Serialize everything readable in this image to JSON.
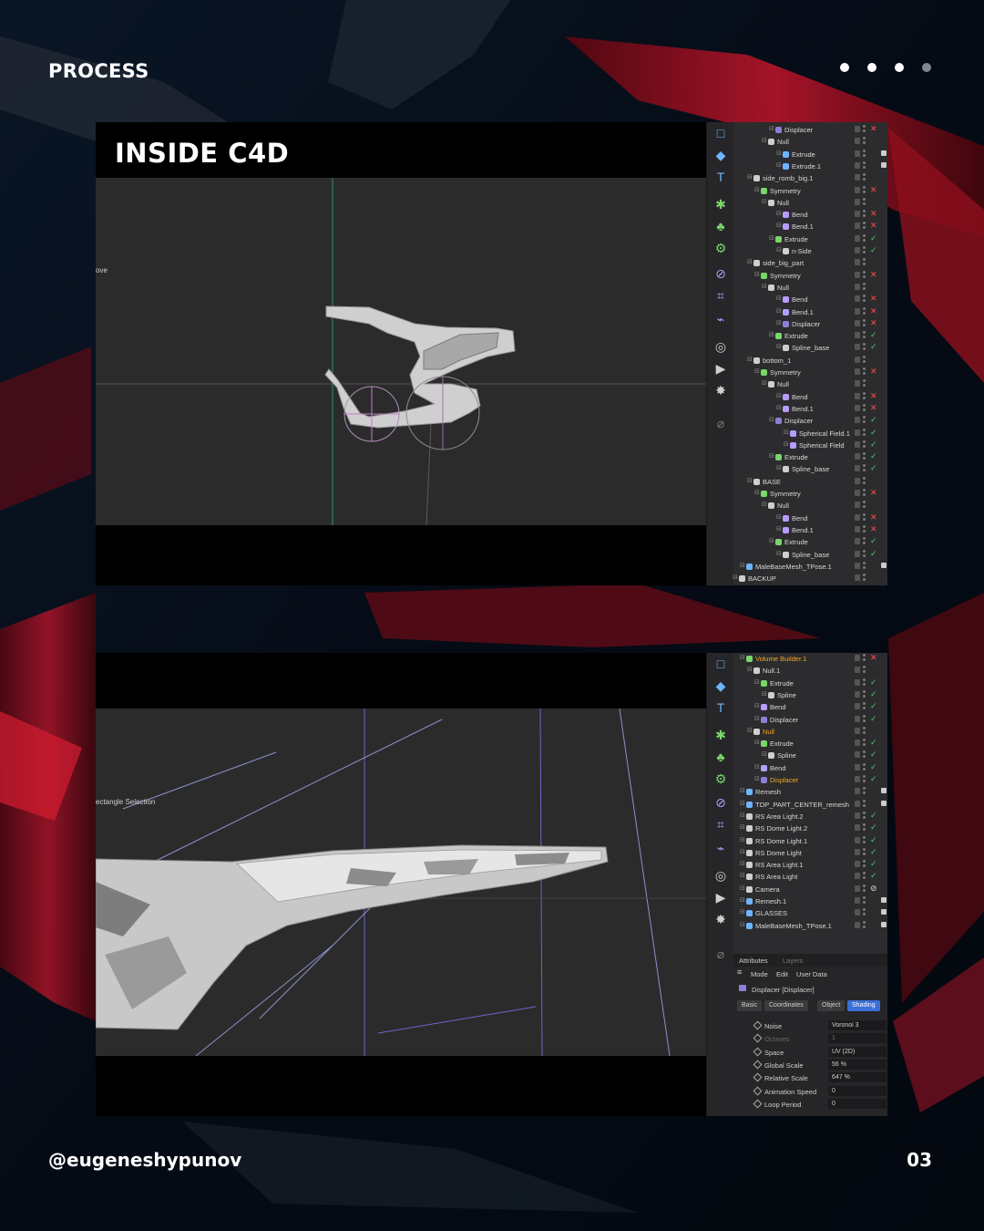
{
  "header": {
    "label": "PROCESS",
    "dots": [
      true,
      true,
      true,
      false
    ]
  },
  "footer": {
    "handle": "@eugeneshypunov",
    "page": "03"
  },
  "colors": {
    "background": "#06101e",
    "accent_red": "#b01622",
    "viewport": "#2b2b2c",
    "active_tab": "#3b6fd8"
  },
  "window1": {
    "title": "INSIDE C4D",
    "viewport_tool": "ove",
    "tree": [
      {
        "label": "Displacer",
        "indent": 5,
        "icon": "displacer-icon",
        "flag": "x"
      },
      {
        "label": "Null",
        "indent": 4,
        "icon": "null-icon",
        "flag": ""
      },
      {
        "label": "Extrude",
        "indent": 6,
        "icon": "mesh-icon",
        "flag": "tag"
      },
      {
        "label": "Extrude.1",
        "indent": 6,
        "icon": "mesh-icon",
        "flag": "tag"
      },
      {
        "label": "side_romb_big.1",
        "indent": 2,
        "icon": "null-icon",
        "flag": ""
      },
      {
        "label": "Symmetry",
        "indent": 3,
        "icon": "symmetry-icon",
        "flag": "x"
      },
      {
        "label": "Null",
        "indent": 4,
        "icon": "null-icon",
        "flag": ""
      },
      {
        "label": "Bend",
        "indent": 6,
        "icon": "deformer-icon",
        "flag": "x"
      },
      {
        "label": "Bend.1",
        "indent": 6,
        "icon": "deformer-icon",
        "flag": "x"
      },
      {
        "label": "Extrude",
        "indent": 5,
        "icon": "extrude-icon",
        "flag": "ok"
      },
      {
        "label": "n-Side",
        "indent": 6,
        "icon": "spline-icon",
        "flag": "ok"
      },
      {
        "label": "side_big_part",
        "indent": 2,
        "icon": "null-icon",
        "flag": ""
      },
      {
        "label": "Symmetry",
        "indent": 3,
        "icon": "symmetry-icon",
        "flag": "x"
      },
      {
        "label": "Null",
        "indent": 4,
        "icon": "null-icon",
        "flag": ""
      },
      {
        "label": "Bend",
        "indent": 6,
        "icon": "deformer-icon",
        "flag": "x"
      },
      {
        "label": "Bend.1",
        "indent": 6,
        "icon": "deformer-icon",
        "flag": "x"
      },
      {
        "label": "Displacer",
        "indent": 6,
        "icon": "displacer-icon",
        "flag": "x"
      },
      {
        "label": "Extrude",
        "indent": 5,
        "icon": "extrude-icon",
        "flag": "ok"
      },
      {
        "label": "Spline_base",
        "indent": 6,
        "icon": "spline-icon",
        "flag": "ok"
      },
      {
        "label": "bottom_1",
        "indent": 2,
        "icon": "null-icon",
        "flag": ""
      },
      {
        "label": "Symmetry",
        "indent": 3,
        "icon": "symmetry-icon",
        "flag": "x"
      },
      {
        "label": "Null",
        "indent": 4,
        "icon": "null-icon",
        "flag": ""
      },
      {
        "label": "Bend",
        "indent": 6,
        "icon": "deformer-icon",
        "flag": "x"
      },
      {
        "label": "Bend.1",
        "indent": 6,
        "icon": "deformer-icon",
        "flag": "x"
      },
      {
        "label": "Displacer",
        "indent": 5,
        "icon": "displacer-icon",
        "flag": "ok"
      },
      {
        "label": "Spherical Field.1",
        "indent": 7,
        "icon": "field-icon",
        "flag": "ok"
      },
      {
        "label": "Spherical Field",
        "indent": 7,
        "icon": "field-icon",
        "flag": "ok"
      },
      {
        "label": "Extrude",
        "indent": 5,
        "icon": "extrude-icon",
        "flag": "ok"
      },
      {
        "label": "Spline_base",
        "indent": 6,
        "icon": "spline-icon",
        "flag": "ok"
      },
      {
        "label": "BASE",
        "indent": 2,
        "icon": "null-icon",
        "flag": ""
      },
      {
        "label": "Symmetry",
        "indent": 3,
        "icon": "symmetry-icon",
        "flag": "x"
      },
      {
        "label": "Null",
        "indent": 4,
        "icon": "null-icon",
        "flag": ""
      },
      {
        "label": "Bend",
        "indent": 6,
        "icon": "deformer-icon",
        "flag": "x"
      },
      {
        "label": "Bend.1",
        "indent": 6,
        "icon": "deformer-icon",
        "flag": "x"
      },
      {
        "label": "Extrude",
        "indent": 5,
        "icon": "extrude-icon",
        "flag": "ok"
      },
      {
        "label": "Spline_base",
        "indent": 6,
        "icon": "spline-icon",
        "flag": "ok"
      },
      {
        "label": "MaleBaseMesh_TPose.1",
        "indent": 1,
        "icon": "mesh-icon",
        "flag": "tag"
      },
      {
        "label": "BACKUP",
        "indent": 0,
        "icon": "null-icon",
        "flag": ""
      }
    ]
  },
  "window2": {
    "viewport_tool": "ectangle Selection",
    "tree": [
      {
        "label": "Volume Builder.1",
        "indent": 1,
        "icon": "volume-icon",
        "flag": "x",
        "hl": true
      },
      {
        "label": "Null.1",
        "indent": 2,
        "icon": "null-icon",
        "flag": ""
      },
      {
        "label": "Extrude",
        "indent": 3,
        "icon": "extrude-icon",
        "flag": "ok"
      },
      {
        "label": "Spline",
        "indent": 4,
        "icon": "spline-icon",
        "flag": "ok"
      },
      {
        "label": "Bend",
        "indent": 3,
        "icon": "deformer-icon",
        "flag": "ok"
      },
      {
        "label": "Displacer",
        "indent": 3,
        "icon": "displacer-icon",
        "flag": "ok"
      },
      {
        "label": "Null",
        "indent": 2,
        "icon": "null-icon",
        "flag": "",
        "hl": true
      },
      {
        "label": "Extrude",
        "indent": 3,
        "icon": "extrude-icon",
        "flag": "ok"
      },
      {
        "label": "Spline",
        "indent": 4,
        "icon": "spline-icon",
        "flag": "ok"
      },
      {
        "label": "Bend",
        "indent": 3,
        "icon": "deformer-icon",
        "flag": "ok"
      },
      {
        "label": "Displacer",
        "indent": 3,
        "icon": "displacer-icon",
        "flag": "ok",
        "hl": true
      },
      {
        "label": "Remesh",
        "indent": 1,
        "icon": "mesh-icon",
        "flag": "tag"
      },
      {
        "label": "TOP_PART_CENTER_remesh",
        "indent": 1,
        "icon": "mesh-icon",
        "flag": "tag"
      },
      {
        "label": "RS Area Light.2",
        "indent": 1,
        "icon": "light-icon",
        "flag": "ok"
      },
      {
        "label": "RS Dome Light.2",
        "indent": 1,
        "icon": "dome-icon",
        "flag": "ok"
      },
      {
        "label": "RS Dome Light.1",
        "indent": 1,
        "icon": "dome-icon",
        "flag": "ok"
      },
      {
        "label": "RS Dome Light",
        "indent": 1,
        "icon": "dome-icon",
        "flag": "ok"
      },
      {
        "label": "RS Area Light.1",
        "indent": 1,
        "icon": "light-icon",
        "flag": "ok"
      },
      {
        "label": "RS Area Light",
        "indent": 1,
        "icon": "light-icon",
        "flag": "ok"
      },
      {
        "label": "Camera",
        "indent": 1,
        "icon": "camera-icon",
        "flag": "off"
      },
      {
        "label": "Remesh.1",
        "indent": 1,
        "icon": "mesh-icon",
        "flag": "tag"
      },
      {
        "label": "GLASSES",
        "indent": 1,
        "icon": "mesh-icon",
        "flag": "tag"
      },
      {
        "label": "MaleBaseMesh_TPose.1",
        "indent": 1,
        "icon": "mesh-icon",
        "flag": "tag"
      }
    ],
    "attributes": {
      "tab_attributes": "Attributes",
      "tab_layers": "Layers",
      "menu_mode": "Mode",
      "menu_edit": "Edit",
      "menu_userdata": "User Data",
      "object_title": "Displacer [Displacer]",
      "subtabs": [
        "Basic",
        "Coordinates",
        "Object",
        "Shading"
      ],
      "active_subtab": "Shading",
      "props": [
        {
          "label": "Noise",
          "value": "Voronoi 3"
        },
        {
          "label": "Octaves",
          "value": "1",
          "dim": true
        },
        {
          "label": "Space",
          "value": "UV (2D)"
        },
        {
          "label": "Global Scale",
          "value": "56 %"
        },
        {
          "label": "Relative Scale",
          "value": "647 %"
        },
        {
          "label": "Animation Speed",
          "value": "0"
        },
        {
          "label": "Loop Period",
          "value": "0"
        }
      ]
    }
  }
}
